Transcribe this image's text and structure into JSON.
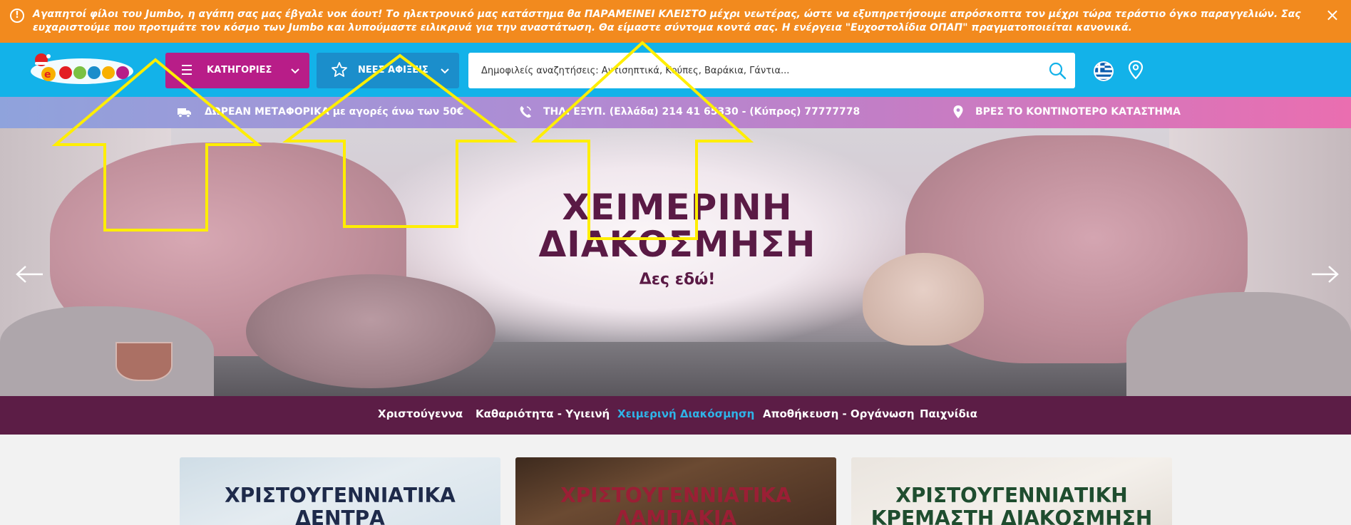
{
  "alert": {
    "message": "Αγαπητοί φίλοι του Jumbo, η αγάπη σας μας έβγαλε νοκ άουτ! Το ηλεκτρονικό μας κατάστημα θα ΠΑΡΑΜΕΙΝΕΙ ΚΛΕΙΣΤΟ μέχρι νεωτέρας, ώστε να εξυπηρετήσουμε απρόσκοπτα τον μέχρι τώρα τεράστιο όγκο παραγγελιών. Σας ευχαριστούμε που προτιμάτε τον κόσμο των Jumbo και λυπούμαστε ειλικρινά για την αναστάτωση. Θα είμαστε σύντομα κοντά σας. Η ενέργεια \"Ευχοστολίδια ΟΠΑΠ\" πραγματοποιείται κανονικά.",
    "icon": "!",
    "close": "×"
  },
  "header": {
    "categories_label": "ΚΑΤΗΓΟΡΙΕΣ",
    "new_arrivals_label": "ΝΕΕΣ ΑΦΙΞΕΙΣ",
    "search_placeholder": "Δημοφιλείς αναζητήσεις: Αντισηπτικά, Κούπες, Βαράκια, Γάντια..."
  },
  "strip": {
    "shipping": "ΔΩΡΕΑΝ ΜΕΤΑΦΟΡΙΚΑ με αγορές άνω των 50€",
    "phone": "ΤΗΛ. ΕΞΥΠ.  (Ελλάδα) 214 41 65330 - (Κύπρος) 77777778",
    "store": "ΒΡΕΣ ΤΟ ΚΟΝΤΙΝΟΤΕΡΟ ΚΑΤΑΣΤΗΜΑ"
  },
  "hero": {
    "title_line1": "ΧΕΙΜΕΡΙΝΗ",
    "title_line2": "ΔΙΑΚΟΣΜΗΣΗ",
    "subtitle": "Δες εδώ!"
  },
  "catnav": {
    "items": [
      "Χριστούγεννα",
      "Καθαριότητα - Υγιεινή",
      "Χειμερινή Διακόσμηση",
      "Αποθήκευση - Οργάνωση",
      "Παιχνίδια"
    ],
    "active_index": 2
  },
  "cards": [
    {
      "line1": "ΧΡΙΣΤΟΥΓΕΝΝΙΑΤΙΚΑ",
      "line2": "ΔΕΝΤΡΑ"
    },
    {
      "line1": "ΧΡΙΣΤΟΥΓΕΝΝΙΑΤΙΚΑ",
      "line2": "ΛΑΜΠΑΚΙΑ"
    },
    {
      "line1": "ΧΡΙΣΤΟΥΓΕΝΝΙΑΤΙΚΗ",
      "line2": "ΚΡΕΜΑΣΤΗ ΔΙΑΚΟΣΜΗΣΗ"
    }
  ],
  "colors": {
    "alert": "#f28a1e",
    "header": "#13b2e9",
    "categories_button": "#b81d88",
    "new_arrivals_button": "#1b8ecb",
    "catnav": "#5c1d46",
    "catnav_active": "#2fb4e8",
    "annotation_arrows": "#ffee00"
  },
  "icons": [
    "alert-icon",
    "close-icon",
    "jumbo-logo",
    "menu-icon",
    "star-icon",
    "chevron-down-icon",
    "search-icon",
    "greek-flag-icon",
    "location-pin-icon",
    "truck-icon",
    "phone-icon",
    "arrow-left-icon",
    "arrow-right-icon"
  ]
}
